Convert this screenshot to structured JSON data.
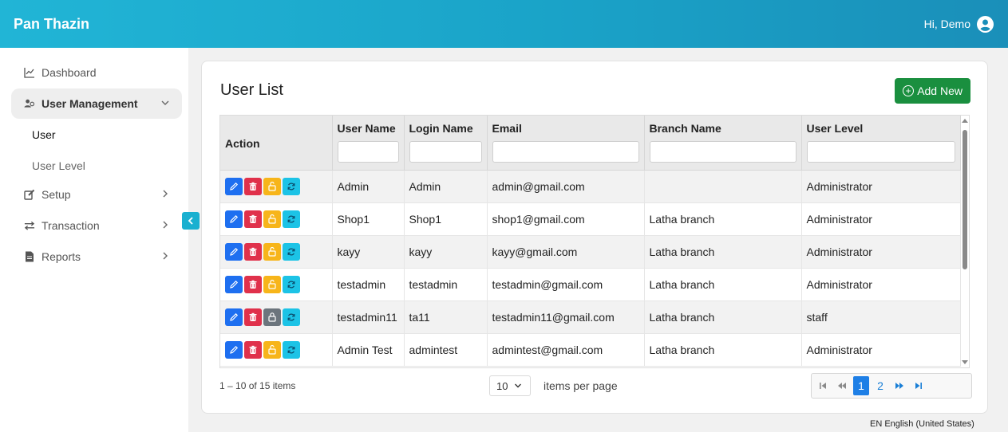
{
  "app": {
    "title": "Pan Thazin",
    "greeting": "Hi, Demo"
  },
  "sidebar": {
    "items": [
      {
        "label": "Dashboard",
        "icon": "chart-line-icon"
      },
      {
        "label": "User Management",
        "icon": "users-icon",
        "expanded": true
      },
      {
        "label": "Setup",
        "icon": "edit-icon"
      },
      {
        "label": "Transaction",
        "icon": "exchange-icon"
      },
      {
        "label": "Reports",
        "icon": "file-icon"
      }
    ],
    "sub_items": [
      "User",
      "User Level"
    ]
  },
  "page": {
    "title": "User List",
    "add_label": "Add New"
  },
  "table": {
    "columns": [
      "Action",
      "User Name",
      "Login Name",
      "Email",
      "Branch Name",
      "User Level"
    ],
    "rows": [
      {
        "user_name": "Admin",
        "login_name": "Admin",
        "email": "admin@gmail.com",
        "branch": "",
        "level": "Administrator",
        "locked": false
      },
      {
        "user_name": "Shop1",
        "login_name": "Shop1",
        "email": "shop1@gmail.com",
        "branch": "Latha branch",
        "level": "Administrator",
        "locked": false
      },
      {
        "user_name": "kayy",
        "login_name": "kayy",
        "email": "kayy@gmail.com",
        "branch": "Latha branch",
        "level": "Administrator",
        "locked": false
      },
      {
        "user_name": "testadmin",
        "login_name": "testadmin",
        "email": "testadmin@gmail.com",
        "branch": "Latha branch",
        "level": "Administrator",
        "locked": false
      },
      {
        "user_name": "testadmin11",
        "login_name": "ta11",
        "email": "testadmin11@gmail.com",
        "branch": "Latha branch",
        "level": "staff",
        "locked": true
      },
      {
        "user_name": "Admin Test",
        "login_name": "admintest",
        "email": "admintest@gmail.com",
        "branch": "Latha branch",
        "level": "Administrator",
        "locked": false
      }
    ]
  },
  "pager": {
    "info": "1 – 10 of 15 items",
    "page_size": "10",
    "items_per_page_label": "items per page",
    "pages": [
      "1",
      "2"
    ],
    "current_page": "1"
  },
  "status": {
    "language": "EN English (United States)"
  },
  "colors": {
    "accent": "#1aa3c8",
    "add_button": "#1a8f3f",
    "edit": "#1e6ff0",
    "delete": "#e0314b",
    "unlock": "#f7b51a",
    "locked": "#6c757d",
    "reset": "#1cc3e6"
  }
}
